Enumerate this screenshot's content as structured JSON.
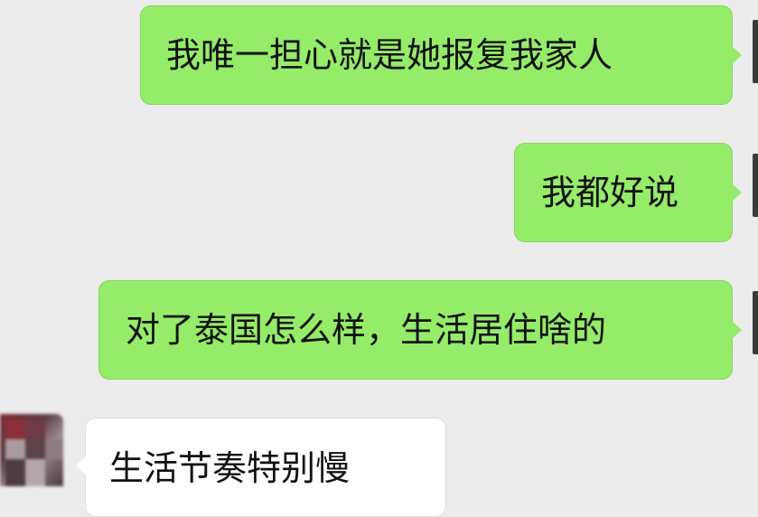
{
  "chat": {
    "messages": [
      {
        "direction": "outgoing",
        "text": "我唯一担心就是她报复我家人"
      },
      {
        "direction": "outgoing",
        "text": "我都好说"
      },
      {
        "direction": "outgoing",
        "text": "对了泰国怎么样，生活居住啥的"
      },
      {
        "direction": "incoming",
        "text": "生活节奏特别慢"
      }
    ]
  },
  "colors": {
    "background": "#ececec",
    "outgoing_bubble": "#95ec69",
    "incoming_bubble": "#ffffff",
    "text": "#111111"
  },
  "icons": {
    "contact_avatar": "blurred-avatar-icon",
    "own_avatar": "own-avatar-icon"
  }
}
